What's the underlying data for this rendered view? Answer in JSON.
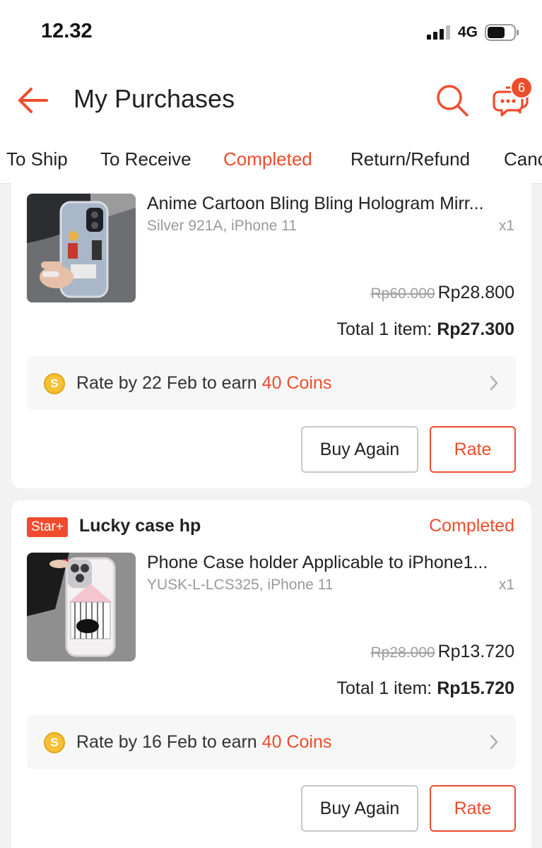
{
  "status_bar": {
    "time": "12.32",
    "network": "4G"
  },
  "header": {
    "title": "My Purchases",
    "chat_badge": "6"
  },
  "tabs": [
    {
      "label": "To Ship"
    },
    {
      "label": "To Receive"
    },
    {
      "label": "Completed",
      "active": true
    },
    {
      "label": "Return/Refund"
    },
    {
      "label": "Canc"
    }
  ],
  "orders": [
    {
      "product_name": "Anime Cartoon Bling Bling Hologram Mirr...",
      "variant": "Silver 921A, iPhone 11",
      "qty": "x1",
      "original_price": "Rp60.000",
      "price": "Rp28.800",
      "total_label": "Total 1 item:",
      "total": "Rp27.300",
      "rate_prefix": "Rate by 22 Feb to earn",
      "rate_coins": "40 Coins",
      "buy_again": "Buy Again",
      "rate": "Rate"
    },
    {
      "badge": "Star+",
      "shop": "Lucky case hp",
      "status": "Completed",
      "product_name": "Phone Case holder Applicable to iPhone1...",
      "variant": "YUSK-L-LCS325, iPhone 11",
      "qty": "x1",
      "original_price": "Rp28.000",
      "price": "Rp13.720",
      "total_label": "Total 1 item:",
      "total": "Rp15.720",
      "rate_prefix": "Rate by 16 Feb to earn",
      "rate_coins": "40 Coins",
      "buy_again": "Buy Again",
      "rate": "Rate"
    }
  ],
  "colors": {
    "accent": "#ee4d2d",
    "coin": "#f6c233",
    "background": "#f2f2f2"
  },
  "icons": [
    "back-arrow-icon",
    "search-icon",
    "chat-icon",
    "coin-icon",
    "chevron-right-icon"
  ]
}
